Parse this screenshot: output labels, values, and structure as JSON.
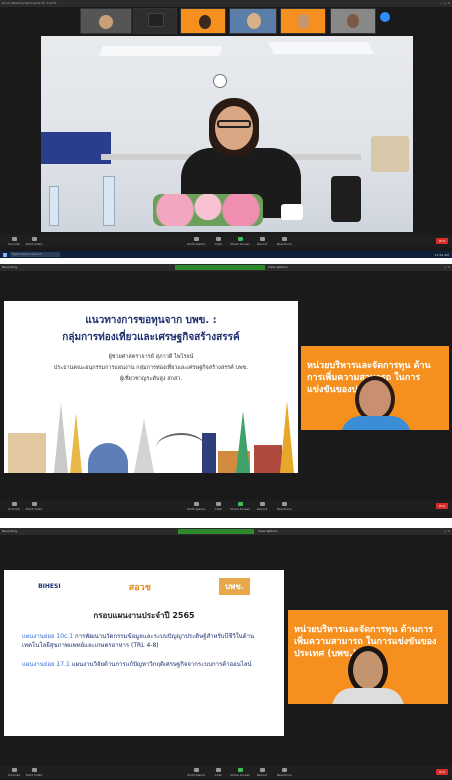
{
  "shots": [
    {
      "title": "Zoom Meeting Participant ID: 14779",
      "thumbs": [
        {
          "name": "",
          "bg": "#555"
        },
        {
          "name": "ZOOM ROOM",
          "bg": "#2e2e2e"
        },
        {
          "name": "",
          "bg": "#f5901e"
        },
        {
          "name": "",
          "bg": "#5b7ea8"
        },
        {
          "name": "",
          "bg": "#f5901e"
        },
        {
          "name": "",
          "bg": "#888"
        }
      ],
      "search_placeholder": "Type here to search",
      "clock": "10:52 AM"
    },
    {
      "recording": "Recording",
      "view": "View Options",
      "slide": {
        "title": "แนวทางการขอทุนจาก บพข. :",
        "subtitle": "กลุ่มการท่องเที่ยวและเศรษฐกิจสร้างสรรค์",
        "line1": "ผู้ช่วยศาสตราจารย์ สุภาวดี ไพโรจน์",
        "line2": "ประธานคณะอนุกรรมการแผนงาน กลุ่มการท่องเที่ยวและเศรษฐกิจสร้างสรรค์ บพข.",
        "line3": "ผู้เชี่ยวชาญระดับสูง สกสว."
      },
      "cam_text": "หน่วยบริหารและจัดการทุน ด้านการเพิ่มความสามารถ ในการแข่งขันของประเทศ"
    },
    {
      "recording": "Recording",
      "view": "View Options",
      "slide": {
        "logo1": "BIHESI",
        "logo2": "สอวช",
        "logo3": "บพข.",
        "heading": "กรอบแผนงานประจำปี 2565",
        "item1_label": "แผนงานย่อย 10c.1",
        "item1_text": "การพัฒนานวัตกรรมข้อมูลและระบบปัญญาประดิษฐ์สำหรับบีชีวิในด้านเทคโนโลยีสุขภาพแพทย์และเกษตรอาหาร (TRL 4-8)",
        "item2_label": "แผนงานย่อย 17.1",
        "item2_text": "แผนงานวิจัยด้านการแก้ปัญหาวิกฤติเศรษฐกิจจากระบบการค้าออนไลน์"
      },
      "cam_text": "หน่วยบริหารและจัดการทุน ด้านการเพิ่มความสามารถ ในการแข่งขันของประเทศ (บพข.)"
    }
  ],
  "toolbar": {
    "mute": "Unmute",
    "video": "Start Video",
    "participants": "Participants",
    "chat": "Chat",
    "share": "Share Screen",
    "record": "Record",
    "reactions": "Reactions",
    "end": "End"
  }
}
